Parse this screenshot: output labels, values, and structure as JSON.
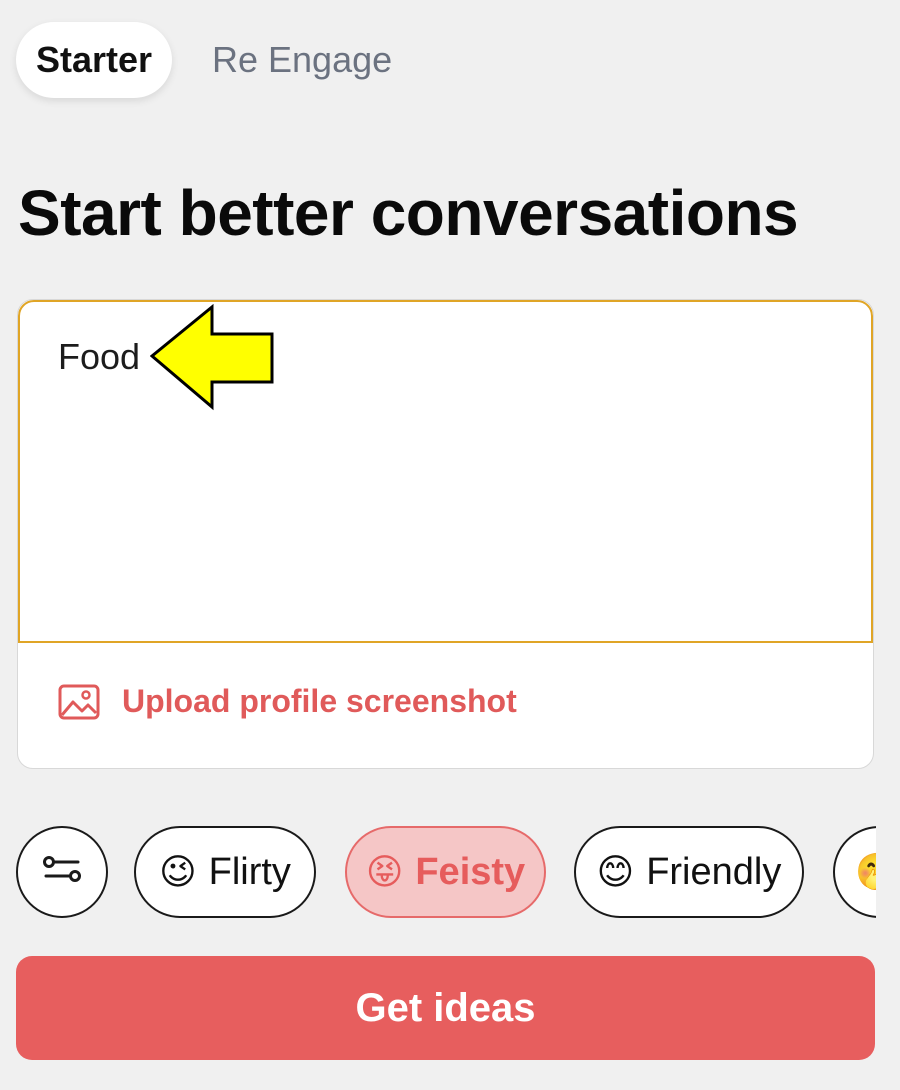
{
  "tabs": [
    {
      "label": "Starter",
      "active": true
    },
    {
      "label": "Re Engage",
      "active": false
    }
  ],
  "title": "Start better conversations",
  "prompt": {
    "value": "Food"
  },
  "upload": {
    "label": "Upload profile screenshot",
    "icon": "image-icon"
  },
  "filter": {
    "icon": "sliders-icon"
  },
  "tones": [
    {
      "emoji": "😉",
      "label": "Flirty",
      "selected": false
    },
    {
      "emoji": "😝",
      "label": "Feisty",
      "selected": true
    },
    {
      "emoji": "😊",
      "label": "Friendly",
      "selected": false
    },
    {
      "emoji": "🤭",
      "label": "",
      "selected": false
    }
  ],
  "cta": {
    "label": "Get ideas"
  },
  "colors": {
    "background": "#f0f0f0",
    "accent": "#e75e5e",
    "accent_light": "#f5c6c6",
    "input_border": "#e0a526",
    "annotation_arrow": "#ffff00"
  }
}
